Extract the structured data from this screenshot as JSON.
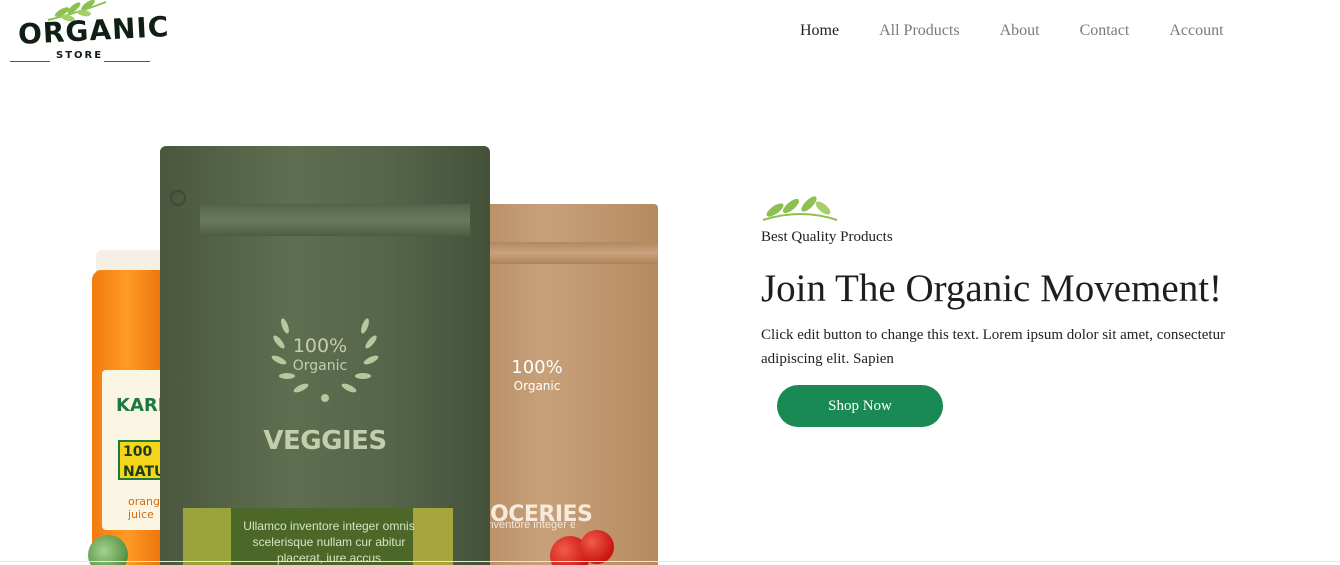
{
  "brand": {
    "logo_word": "ORGANIC",
    "logo_sub": "STORE"
  },
  "nav": {
    "items": [
      {
        "label": "Home",
        "active": true
      },
      {
        "label": "All Products",
        "active": false
      },
      {
        "label": "About",
        "active": false
      },
      {
        "label": "Contact",
        "active": false
      },
      {
        "label": "Account",
        "active": false
      }
    ]
  },
  "hero_image": {
    "jar_brand": "KARI",
    "jar_badge": "100 NATURA",
    "jar_flavor": "orang juice",
    "green_bag_percent": "100%",
    "green_bag_percent_sub": "Organic",
    "green_bag_title": "VEGGIES",
    "green_bag_panel_text": "Ullamco inventore integer omnis scelerisque nullam cur abitur placerat, iure accus",
    "brown_bag_percent": "100%",
    "brown_bag_percent_sub": "Organic",
    "brown_bag_title": "OCERIES",
    "brown_bag_panel_text": "inventore integer elerisque nul elacerat, iur"
  },
  "hero": {
    "eyebrow": "Best Quality Products",
    "headline": "Join The Organic Movement!",
    "body": "Click edit button to change this text. Lorem ipsum dolor sit amet, consectetur adipiscing elit. Sapien",
    "cta_label": "Shop Now"
  },
  "colors": {
    "accent": "#1a8a54",
    "leaf": "#8cc152",
    "text": "#222222",
    "nav_inactive": "#7a7a7a"
  },
  "icons": [
    "leaf-sprig-icon",
    "logo-leaf-icon",
    "laurel-wreath-icon"
  ]
}
